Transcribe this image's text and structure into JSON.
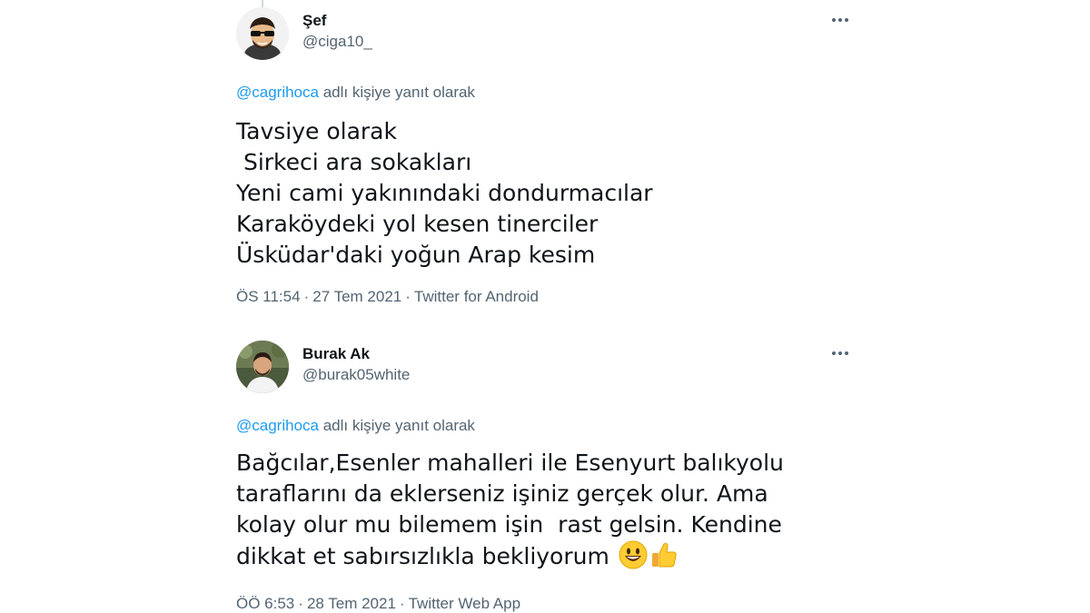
{
  "tweets": [
    {
      "display_name": "Şef",
      "handle": "@ciga10_",
      "reply_user": "@cagrihoca",
      "reply_suffix": " adlı kişiye yanıt olarak",
      "text": "Tavsiye olarak\n Sirkeci ara sokakları\nYeni cami yakınındaki dondurmacılar\nKaraköydeki yol kesen tinerciler\nÜsküdar'daki yoğun Arap kesim",
      "time": "ÖS 11:54",
      "date": "27 Tem 2021",
      "source": "Twitter for Android",
      "separator": "·",
      "more_icon": "more-horizontal-icon"
    },
    {
      "display_name": "Burak Ak",
      "handle": "@burak05white",
      "reply_user": "@cagrihoca",
      "reply_suffix": " adlı kişiye yanıt olarak",
      "text": "Bağcılar,Esenler mahalleri ile Esenyurt balıkyolu tarafl­arını da eklerseniz işiniz gerçek olur. Ama kolay olur mu bilemem işin  rast gelsin. Kendine dikkat et sabırsızlıkla bekliyorum",
      "emojis": [
        "smiling-face-emoji",
        "thumbs-up-emoji"
      ],
      "time": "ÖÖ 6:53",
      "date": "28 Tem 2021",
      "source": "Twitter Web App",
      "separator": "·",
      "more_icon": "more-horizontal-icon"
    }
  ],
  "colors": {
    "link": "#1d9bf0",
    "secondary_text": "#536471",
    "primary_text": "#0f1419"
  }
}
